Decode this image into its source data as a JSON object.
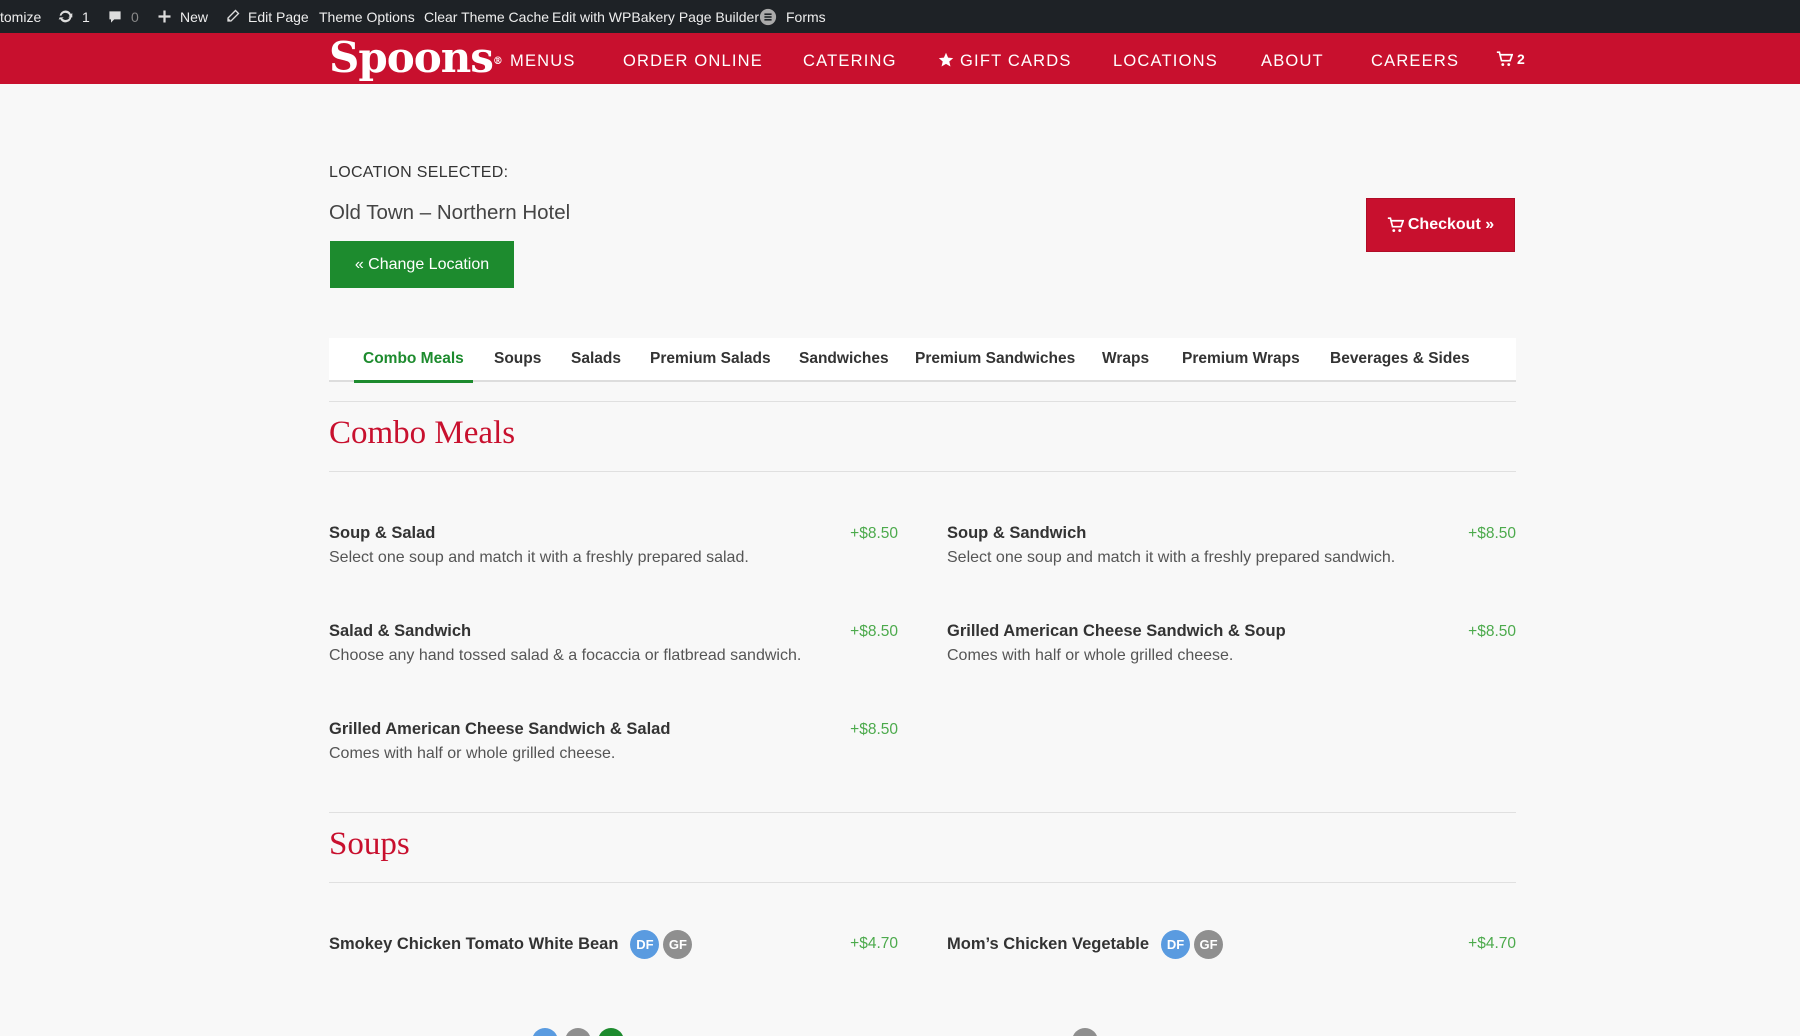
{
  "adminbar": {
    "customize": "tomize",
    "updates_count": "1",
    "comments_count": "0",
    "new_label": "New",
    "edit_page": "Edit Page",
    "theme_options": "Theme Options",
    "clear_cache": "Clear Theme Cache",
    "wpbakery": "Edit with WPBakery Page Builder",
    "forms": "Forms"
  },
  "nav": {
    "logo": "Spoons",
    "logo_mark": "®",
    "items": [
      "MENUS",
      "ORDER ONLINE",
      "CATERING",
      "GIFT CARDS",
      "LOCATIONS",
      "ABOUT",
      "CAREERS"
    ],
    "cart_count": "2"
  },
  "location": {
    "label": "LOCATION SELECTED:",
    "name": "Old Town – Northern Hotel",
    "change_button": "« Change Location",
    "checkout_button": "Checkout »"
  },
  "tabs": [
    "Combo Meals",
    "Soups",
    "Salads",
    "Premium Salads",
    "Sandwiches",
    "Premium Sandwiches",
    "Wraps",
    "Premium Wraps",
    "Beverages & Sides"
  ],
  "sections": {
    "combo": {
      "title": "Combo Meals",
      "items": [
        {
          "name": "Soup & Salad",
          "desc": "Select one soup and match it with a freshly prepared salad.",
          "price": "+$8.50"
        },
        {
          "name": "Soup & Sandwich",
          "desc": "Select one soup and match it with a freshly prepared sandwich.",
          "price": "+$8.50"
        },
        {
          "name": "Salad & Sandwich",
          "desc": "Choose any hand tossed salad & a focaccia or flatbread sandwich.",
          "price": "+$8.50"
        },
        {
          "name": "Grilled American Cheese Sandwich & Soup",
          "desc": "Comes with half or whole grilled cheese.",
          "price": "+$8.50"
        },
        {
          "name": "Grilled American Cheese Sandwich & Salad",
          "desc": "Comes with half or whole grilled cheese.",
          "price": "+$8.50"
        }
      ]
    },
    "soups": {
      "title": "Soups",
      "items": [
        {
          "name": "Smokey Chicken Tomato White Bean",
          "badges": [
            "DF",
            "GF"
          ],
          "price": "+$4.70"
        },
        {
          "name": "Mom’s Chicken Vegetable",
          "badges": [
            "DF",
            "GF"
          ],
          "price": "+$4.70"
        }
      ]
    }
  },
  "colors": {
    "brand_red": "#c8102e",
    "green": "#1d8b2e",
    "price_green": "#4caa4c",
    "badge_df": "#5a9be0",
    "badge_gf": "#8f8f8f",
    "admin_bg": "#1e2226"
  }
}
